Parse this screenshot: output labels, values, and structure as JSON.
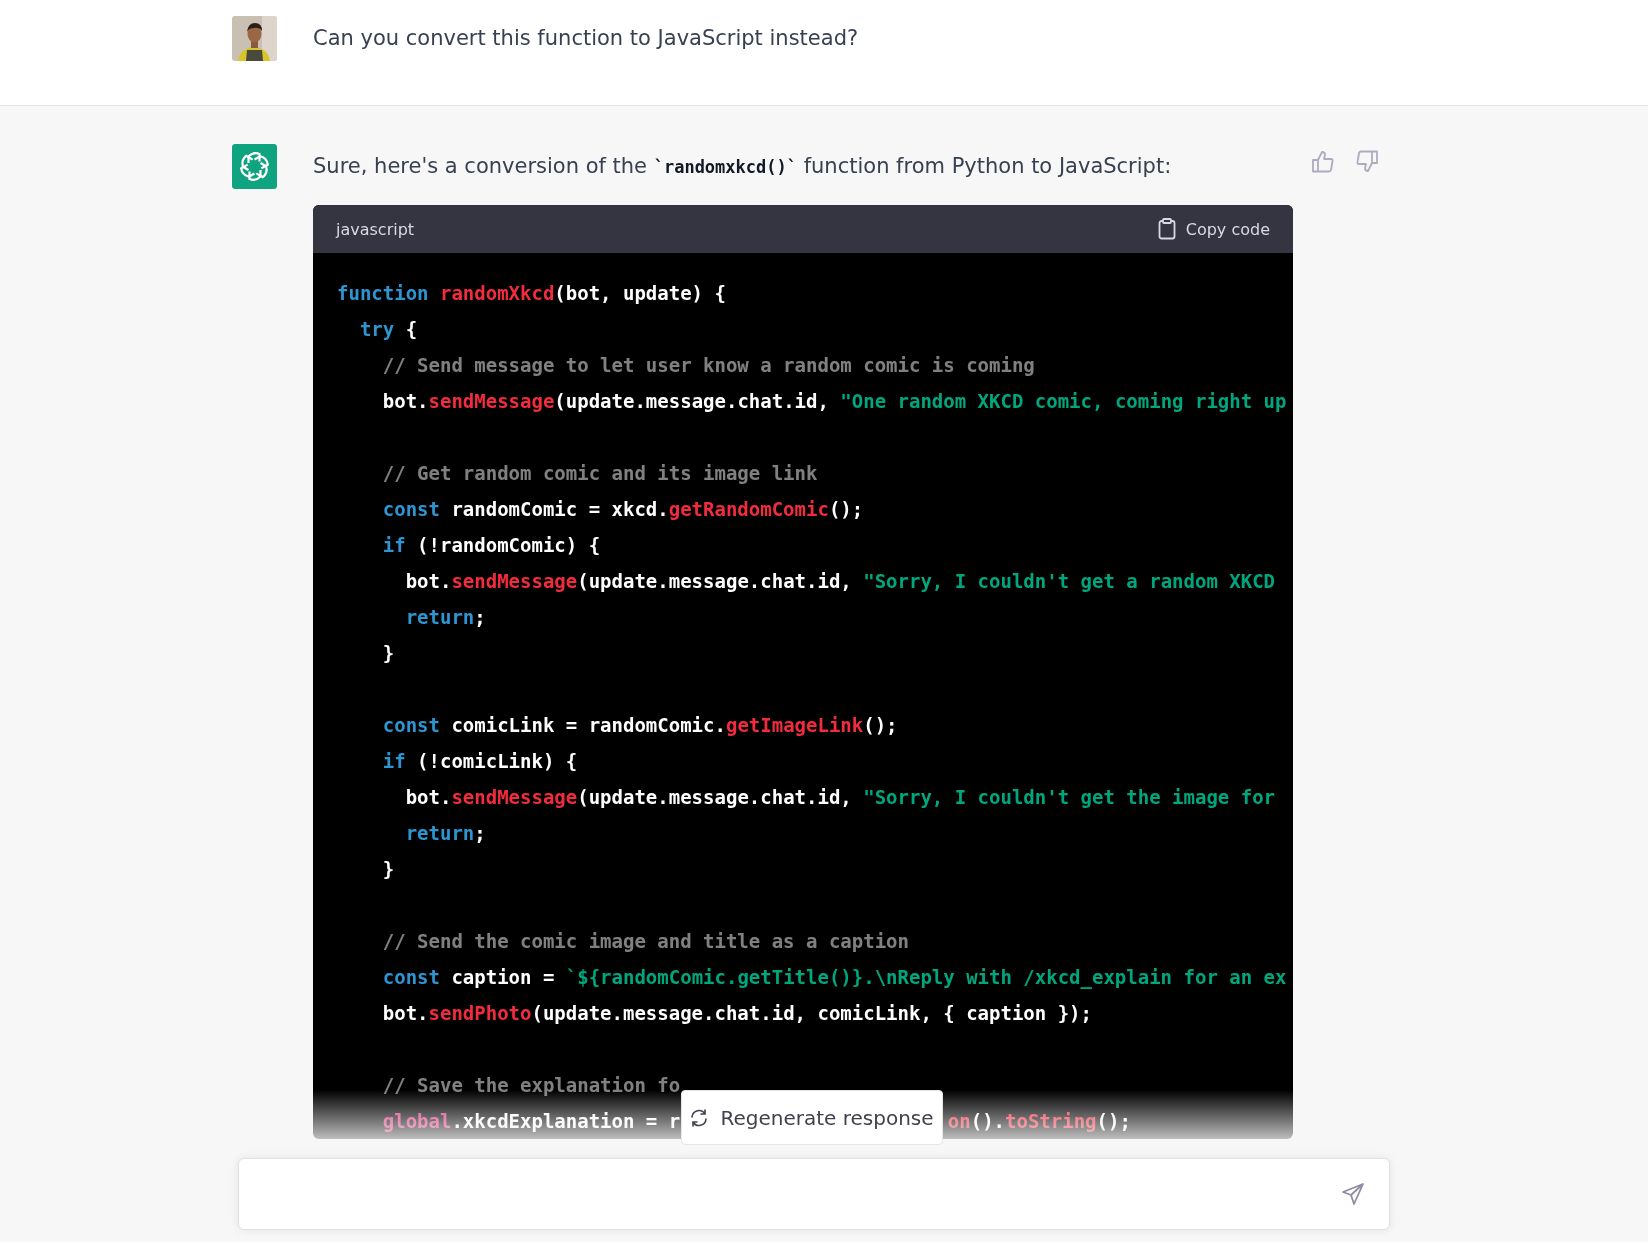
{
  "messages": [
    {
      "kind": "user",
      "parts": [
        {
          "kind": "text",
          "text": "Can you convert this function to JavaScript instead?"
        }
      ]
    },
    {
      "kind": "assistant",
      "parts": [
        {
          "kind": "text",
          "text": "Sure, here's a conversion of the "
        },
        {
          "kind": "code",
          "text": "`randomxkcd()`"
        },
        {
          "kind": "text",
          "text": " function from Python to JavaScript:"
        }
      ],
      "code": {
        "language": "javascript",
        "copy_label": "Copy code",
        "lines": [
          {
            "kind": "code",
            "tokens": [
              {
                "kind": "keyword",
                "text": "function "
              },
              {
                "kind": "call",
                "text": "randomXkcd"
              },
              {
                "kind": "plain",
                "text": "(bot, update) {"
              }
            ]
          },
          {
            "kind": "code",
            "tokens": [
              {
                "kind": "keyword",
                "text": "  try"
              },
              {
                "kind": "plain",
                "text": " {"
              }
            ]
          },
          {
            "kind": "code",
            "tokens": [
              {
                "kind": "comment",
                "text": "    // Send message to let user know a random comic is coming"
              }
            ]
          },
          {
            "kind": "code",
            "tokens": [
              {
                "kind": "plain",
                "text": "    bot."
              },
              {
                "kind": "call",
                "text": "sendMessage"
              },
              {
                "kind": "plain",
                "text": "(update.message.chat.id, "
              },
              {
                "kind": "string",
                "text": "\"One random XKCD comic, coming right up"
              }
            ]
          },
          {
            "kind": "blank"
          },
          {
            "kind": "code",
            "tokens": [
              {
                "kind": "comment",
                "text": "    // Get random comic and its image link"
              }
            ]
          },
          {
            "kind": "code",
            "tokens": [
              {
                "kind": "keyword",
                "text": "    const"
              },
              {
                "kind": "plain",
                "text": " randomComic = xkcd."
              },
              {
                "kind": "call",
                "text": "getRandomComic"
              },
              {
                "kind": "plain",
                "text": "();"
              }
            ]
          },
          {
            "kind": "code",
            "tokens": [
              {
                "kind": "keyword",
                "text": "    if"
              },
              {
                "kind": "plain",
                "text": " (!randomComic) {"
              }
            ]
          },
          {
            "kind": "code",
            "tokens": [
              {
                "kind": "plain",
                "text": "      bot."
              },
              {
                "kind": "call",
                "text": "sendMessage"
              },
              {
                "kind": "plain",
                "text": "(update.message.chat.id, "
              },
              {
                "kind": "string",
                "text": "\"Sorry, I couldn't get a random XKCD"
              }
            ]
          },
          {
            "kind": "code",
            "tokens": [
              {
                "kind": "keyword",
                "text": "      return"
              },
              {
                "kind": "plain",
                "text": ";"
              }
            ]
          },
          {
            "kind": "code",
            "tokens": [
              {
                "kind": "plain",
                "text": "    }"
              }
            ]
          },
          {
            "kind": "blank"
          },
          {
            "kind": "code",
            "tokens": [
              {
                "kind": "keyword",
                "text": "    const"
              },
              {
                "kind": "plain",
                "text": " comicLink = randomComic."
              },
              {
                "kind": "call",
                "text": "getImageLink"
              },
              {
                "kind": "plain",
                "text": "();"
              }
            ]
          },
          {
            "kind": "code",
            "tokens": [
              {
                "kind": "keyword",
                "text": "    if"
              },
              {
                "kind": "plain",
                "text": " (!comicLink) {"
              }
            ]
          },
          {
            "kind": "code",
            "tokens": [
              {
                "kind": "plain",
                "text": "      bot."
              },
              {
                "kind": "call",
                "text": "sendMessage"
              },
              {
                "kind": "plain",
                "text": "(update.message.chat.id, "
              },
              {
                "kind": "string",
                "text": "\"Sorry, I couldn't get the image for"
              }
            ]
          },
          {
            "kind": "code",
            "tokens": [
              {
                "kind": "keyword",
                "text": "      return"
              },
              {
                "kind": "plain",
                "text": ";"
              }
            ]
          },
          {
            "kind": "code",
            "tokens": [
              {
                "kind": "plain",
                "text": "    }"
              }
            ]
          },
          {
            "kind": "blank"
          },
          {
            "kind": "code",
            "tokens": [
              {
                "kind": "comment",
                "text": "    // Send the comic image and title as a caption"
              }
            ]
          },
          {
            "kind": "code",
            "tokens": [
              {
                "kind": "keyword",
                "text": "    const"
              },
              {
                "kind": "plain",
                "text": " caption = "
              },
              {
                "kind": "string",
                "text": "`${randomComic.getTitle()}.\\nReply with /xkcd_explain for an ex"
              }
            ]
          },
          {
            "kind": "code",
            "tokens": [
              {
                "kind": "plain",
                "text": "    bot."
              },
              {
                "kind": "call",
                "text": "sendPhoto"
              },
              {
                "kind": "plain",
                "text": "(update.message.chat.id, comicLink, { caption });"
              }
            ]
          },
          {
            "kind": "blank"
          },
          {
            "kind": "code",
            "tokens": [
              {
                "kind": "comment",
                "text": "    // Save the explanation fo"
              }
            ]
          },
          {
            "kind": "code",
            "tokens": [
              {
                "kind": "global",
                "text": "    global"
              },
              {
                "kind": "plain",
                "text": ".xkcdExplanation = r"
              }
            ],
            "tail": [
              {
                "kind": "call",
                "text": "on"
              },
              {
                "kind": "plain",
                "text": "()."
              },
              {
                "kind": "call",
                "text": "toString"
              },
              {
                "kind": "plain",
                "text": "();"
              }
            ]
          }
        ]
      }
    }
  ],
  "regenerate_button": "Regenerate response"
}
